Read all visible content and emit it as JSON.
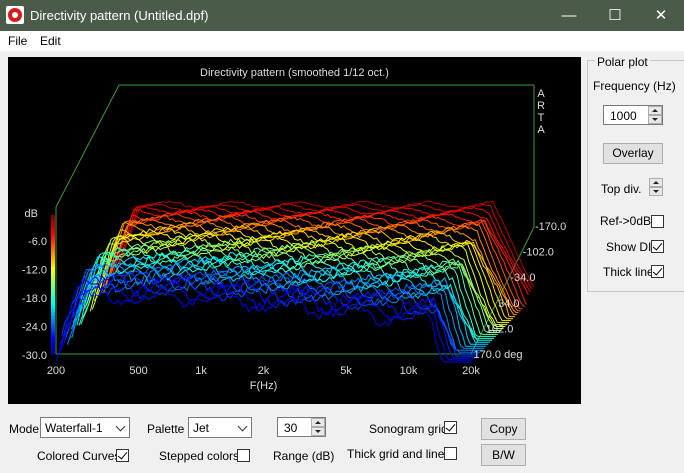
{
  "window": {
    "title": "Directivity pattern (Untitled.dpf)",
    "minimize_glyph": "—",
    "maximize_glyph": "☐",
    "close_glyph": "✕"
  },
  "menu": [
    "File",
    "Edit"
  ],
  "chart_data": {
    "type": "waterfall-3d",
    "title": "Directivity pattern (smoothed 1/12 oct.)",
    "watermark": [
      "A",
      "R",
      "T",
      "A"
    ],
    "xlabel": "F(Hz)",
    "x_ticks": [
      "200",
      "500",
      "1k",
      "2k",
      "5k",
      "10k",
      "20k"
    ],
    "x_scale": "log",
    "xlim": [
      200,
      20000
    ],
    "ylabel": "dB",
    "y_ticks": [
      "-6.0",
      "-12.0",
      "-18.0",
      "-24.0",
      "-30.0"
    ],
    "ylim": [
      -30,
      0
    ],
    "depth_ticks": [
      "-170.0",
      "-102.0",
      "-34.0",
      "34.0",
      "102.0",
      "170.0 deg"
    ],
    "depth_range_deg": [
      -170,
      170
    ],
    "palette": "Jet",
    "colors": [
      "#00008f",
      "#0000ff",
      "#0080ff",
      "#00ffff",
      "#80ff80",
      "#ffff00",
      "#ff8000",
      "#ff0000",
      "#800000"
    ]
  },
  "polar": {
    "group_label": "Polar plot",
    "frequency_label": "Frequency (Hz)",
    "frequency_value": "1000",
    "overlay_label": "Overlay",
    "top_div_label": "Top div.",
    "ref0db_label": "Ref->0dB",
    "ref0db_checked": false,
    "show_di_label": "Show DI",
    "show_di_checked": true,
    "thick_line_label": "Thick line",
    "thick_line_checked": true
  },
  "bottom": {
    "mode_label": "Mode",
    "mode_value": "Waterfall-1",
    "palette_label": "Palette",
    "palette_value": "Jet",
    "range_value": "30",
    "range_label": "Range (dB)",
    "sonogram_grid_label": "Sonogram grid",
    "sonogram_grid_checked": true,
    "colored_curves_label": "Colored Curves",
    "colored_curves_checked": true,
    "stepped_colors_label": "Stepped colors",
    "stepped_colors_checked": false,
    "thick_grid_label": "Thick grid and  lines",
    "thick_grid_checked": false,
    "copy_label": "Copy",
    "bw_label": "B/W"
  }
}
